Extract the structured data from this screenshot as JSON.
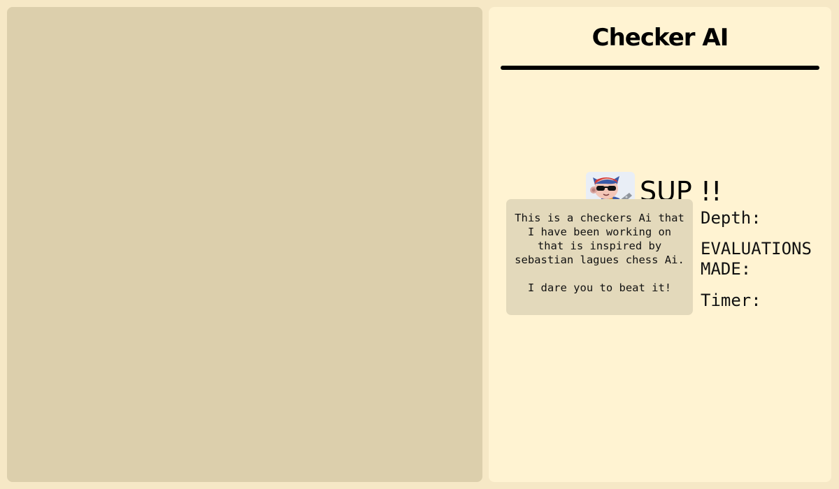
{
  "sidebar": {
    "title": "Checker AI",
    "greeting": "SUP !!",
    "avatar_icon": "cat-with-sunglasses-avatar",
    "description": "This is a checkers Ai that I have been working on that is inspired by sebastian lagues chess Ai.\n\nI dare you to beat it!",
    "stats": {
      "depth_label": "Depth:",
      "evaluations_label": "EVALUATIONS MADE:",
      "timer_label": "Timer:"
    }
  },
  "colors": {
    "page_bg": "#f6e8c6",
    "board_bg": "#dccfac",
    "panel_bg": "#fff3d2",
    "card_bg": "#e3d9bb"
  }
}
